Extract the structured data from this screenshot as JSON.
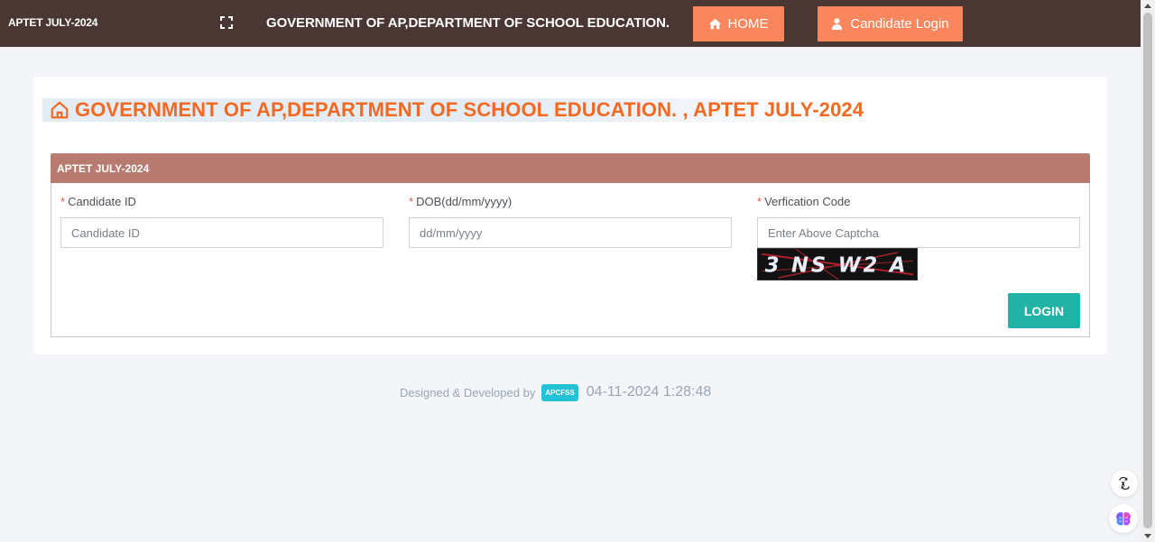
{
  "topbar": {
    "brand": "APTET JULY-2024",
    "title": "GOVERNMENT OF AP,DEPARTMENT OF SCHOOL EDUCATION.",
    "home_label": "HOME",
    "candidate_login_label": "Candidate Login",
    "background_color": "#4a3733",
    "button_color": "#f9865c"
  },
  "page": {
    "title": "GOVERNMENT OF AP,DEPARTMENT OF SCHOOL EDUCATION. , APTET JULY-2024",
    "title_color": "#f26922"
  },
  "panel": {
    "header": "APTET JULY-2024",
    "header_color": "#b87b6f",
    "fields": [
      {
        "label": "Candidate ID",
        "required_mark": "*",
        "placeholder": "Candidate ID",
        "value": ""
      },
      {
        "label": "DOB(dd/mm/yyyy)",
        "required_mark": "*",
        "placeholder": "dd/mm/yyyy",
        "value": ""
      },
      {
        "label": "Verfication Code",
        "required_mark": "*",
        "placeholder": "Enter Above Captcha",
        "value": ""
      }
    ],
    "captcha_text": "3 NS W2 A",
    "login_label": "LOGIN",
    "login_color": "#21b3a5"
  },
  "footer": {
    "designed_by": "Designed & Developed by",
    "badge": "APCFSS",
    "timestamp": "04-11-2024 1:28:48"
  },
  "icons": {
    "fullscreen": "fullscreen-icon",
    "home": "home-icon",
    "user": "user-icon",
    "house_outline": "house-outline-icon",
    "translate": "translate-icon",
    "brain": "brain-icon"
  }
}
